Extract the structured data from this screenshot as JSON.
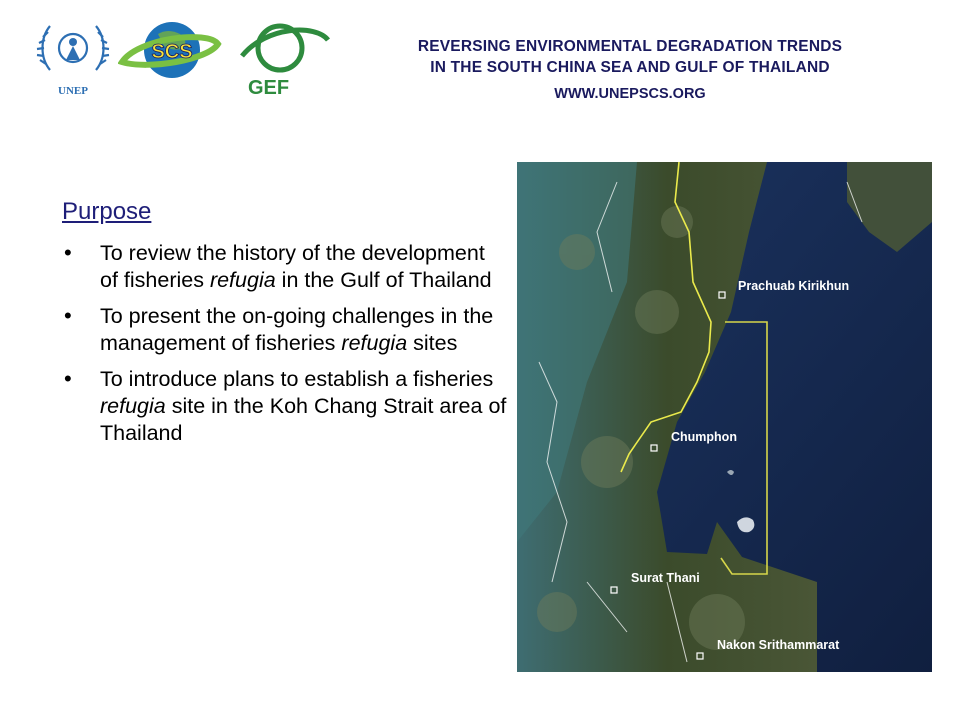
{
  "header": {
    "line1": "REVERSING ENVIRONMENTAL DEGRADATION TRENDS",
    "line2": "IN THE SOUTH CHINA SEA AND GULF OF THAILAND",
    "url": "WWW.UNEPSCS.ORG"
  },
  "logos": {
    "unep_text": "UNEP",
    "scs_text": "SCS",
    "gef_text": "GEF",
    "unep_color": "#2d6fb3",
    "scs_color": "#1d72b8",
    "gef_color": "#2e8b3e"
  },
  "content": {
    "title": "Purpose",
    "bullets": [
      {
        "before": "To review the history of the development of fisheries ",
        "italic": "refugia",
        "after": " in the Gulf of Thailand"
      },
      {
        "before": "To present the on-going challenges in the management of fisheries ",
        "italic": "refugia",
        "after": " sites"
      },
      {
        "before": "To introduce plans to establish a fisheries ",
        "italic": "refugia",
        "after": " site in the Koh Chang Strait area of Thailand"
      }
    ]
  },
  "map": {
    "labels": {
      "prachuap": "Prachuab Kirikhun",
      "chumphon": "Chumphon",
      "surat": "Surat Thani",
      "nakon": "Nakon Srithammarat"
    },
    "colors": {
      "sea": "#14264a",
      "land": "#3a4a2c",
      "border": "#e8e84a",
      "box": "#d6d64a"
    }
  }
}
